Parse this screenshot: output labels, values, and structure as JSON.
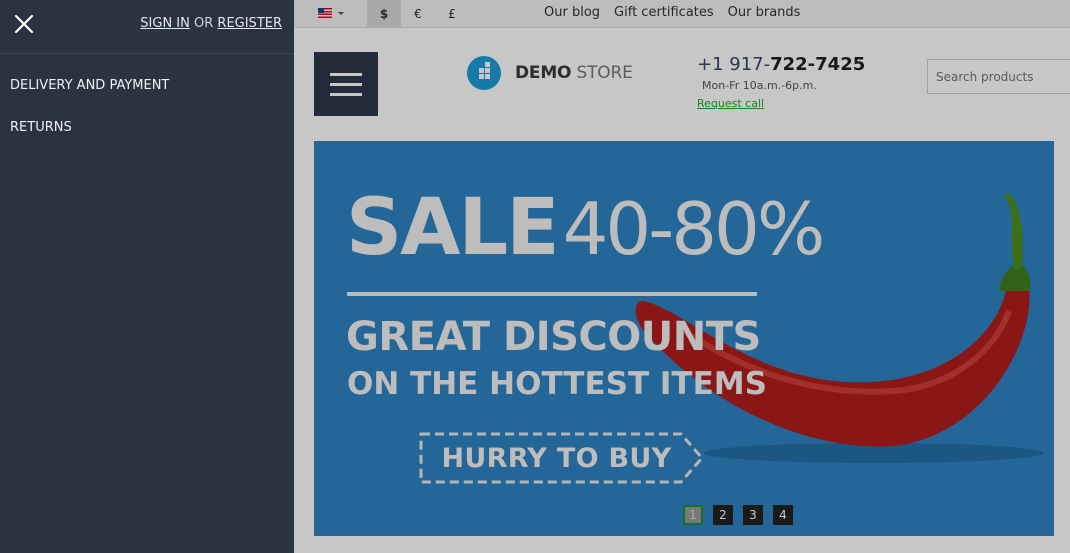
{
  "drawer": {
    "close_label": "×",
    "sign_in": "SIGN IN",
    "or": "OR",
    "register": "REGISTER",
    "menu": [
      {
        "label": "DELIVERY AND PAYMENT"
      },
      {
        "label": "RETURNS"
      }
    ],
    "background": "#2b3242"
  },
  "topbar": {
    "language": "US flag",
    "currencies": [
      "$",
      "€",
      "£"
    ],
    "active_currency": "$",
    "links": [
      "Our blog",
      "Gift certificates",
      "Our brands"
    ]
  },
  "header": {
    "logo_bold": "DEMO",
    "logo_light": "STORE",
    "phone_prefix": "+1 917-",
    "phone_main": "722-7425",
    "hours": "Mon-Fr 10a.m.-6p.m.",
    "request_call": "Request call",
    "search_placeholder": "Search products"
  },
  "banner": {
    "sale_word": "SALE",
    "sale_range": "40-80%",
    "line1": "GREAT DISCOUNTS",
    "line2": "ON THE HOTTEST ITEMS",
    "cta": "HURRY TO BUY",
    "background": "#2f83c2",
    "pages": [
      "1",
      "2",
      "3",
      "4"
    ],
    "active_page": "1"
  }
}
